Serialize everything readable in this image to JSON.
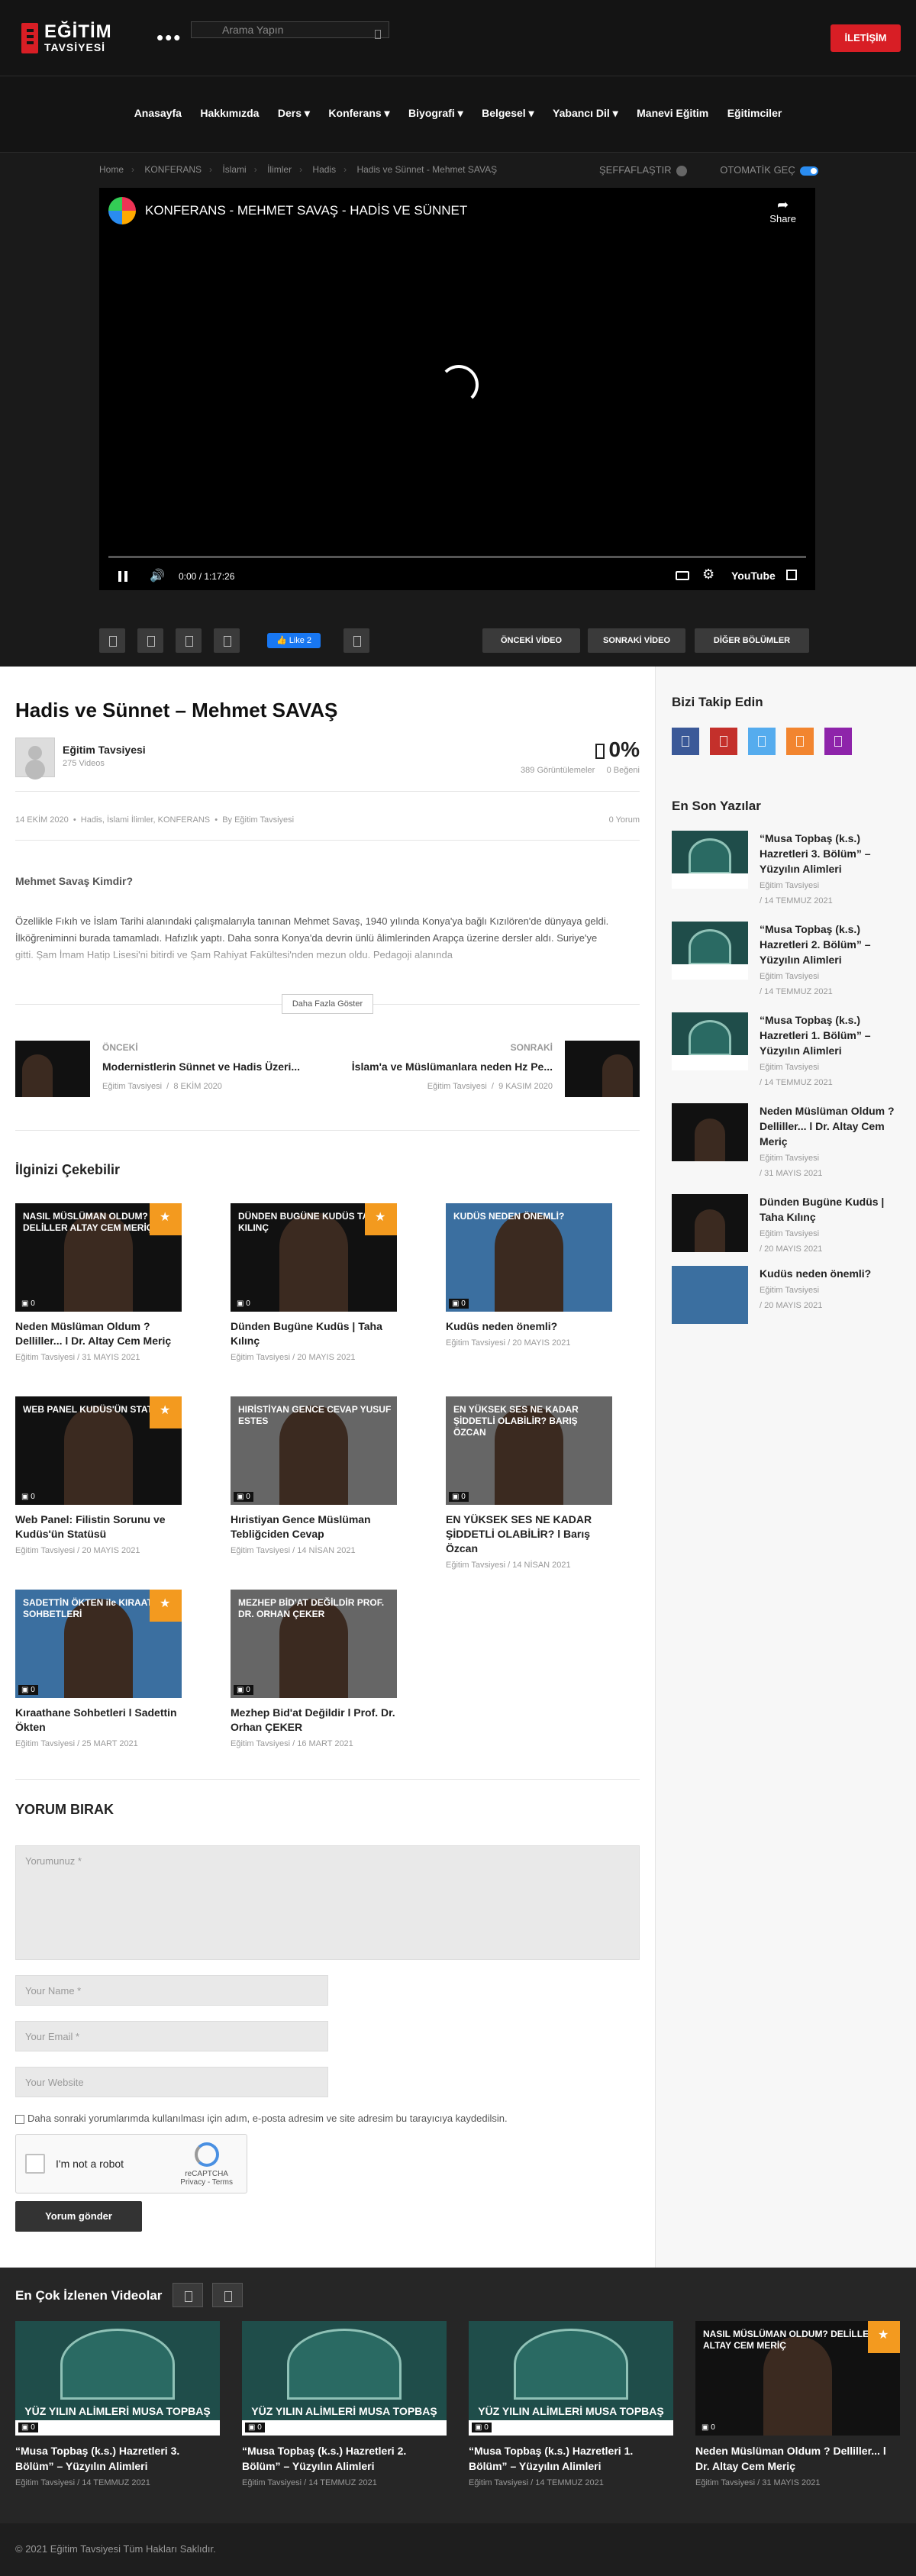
{
  "header": {
    "logo_line1": "EĞİTİM",
    "logo_line2": "TAVSİYESİ",
    "dots": "•••",
    "search_placeholder": "Arama Yapın",
    "contact_label": "İLETİŞİM"
  },
  "nav": {
    "items": [
      "Anasayfa",
      "Hakkımızda",
      "Ders ▾",
      "Konferans ▾",
      "Biyografi ▾",
      "Belgesel ▾",
      "Yabancı Dil ▾",
      "Manevi Eğitim",
      "Eğitimciler"
    ]
  },
  "breadcrumb": {
    "items": [
      "Home",
      "KONFERANS",
      "İslami",
      "İlimler",
      "Hadis",
      "Hadis ve Sünnet - Mehmet SAVAŞ"
    ],
    "sep": "›"
  },
  "toggles": {
    "transparent_label": "ŞEFFAFLAŞTIR",
    "autoplay_label": "OTOMATİK GEÇ"
  },
  "player": {
    "title": "KONFERANS - MEHMET SAVAŞ - HADİS VE SÜNNET",
    "share_label": "Share",
    "time": "0:00 / 1:17:26",
    "brand": "YouTube"
  },
  "toolbar": {
    "like_label": "👍 Like 2",
    "prev_video": "ÖNCEKİ VİDEO",
    "next_video": "SONRAKİ VİDEO",
    "other_episodes": "DİĞER BÖLÜMLER"
  },
  "post": {
    "title": "Hadis ve Sünnet – Mehmet SAVAŞ",
    "author": "Eğitim Tavsiyesi",
    "author_videos": "275 Videos",
    "like_percent": "0%",
    "views": "389 Görüntülemeler",
    "likes": "0 Beğeni",
    "date": "14 EKİM 2020",
    "categories": "Hadis, İslami İlimler, KONFERANS",
    "by": "By Eğitim Tavsiyesi",
    "comments": "0 Yorum",
    "section_title": "Mehmet Savaş Kimdir?",
    "body": "Özellikle Fıkıh ve İslam Tarihi alanındaki çalışmalarıyla tanınan Mehmet Savaş, 1940 yılında Konya'ya bağlı Kızılören'de dünyaya geldi. İlköğreniminni burada tamamladı. Hafızlık yaptı. Daha sonra Konya'da devrin ünlü âlimlerinden Arapça üzerine dersler aldı. Suriye'ye gitti. Şam İmam Hatip Lisesi'ni bitirdi ve Şam Rahiyat Fakültesi'nden mezun oldu. Pedagoji alanında",
    "show_more": "Daha Fazla Göster"
  },
  "prevnext": {
    "prev_tag": "ÖNCEKİ",
    "prev_title": "Modernistlerin Sünnet ve Hadis Üzeri...",
    "prev_author": "Eğitim Tavsiyesi",
    "prev_date": "8 EKİM 2020",
    "next_tag": "SONRAKİ",
    "next_title": "İslam'a ve Müslümanlara neden Hz Pe...",
    "next_author": "Eğitim Tavsiyesi",
    "next_date": "9 KASIM 2020"
  },
  "related": {
    "title": "İlginizi Çekebilir",
    "items": [
      {
        "title": "Neden Müslüman Oldum ? Delliller... l Dr. Altay Cem Meriç",
        "author": "Eğitim Tavsiyesi",
        "date": "31 MAYIS 2021",
        "badge": "▣ 0",
        "thumb_text": "NASIL MÜSLÜMAN OLDUM? DELİLLER ALTAY CEM MERİÇ"
      },
      {
        "title": "Dünden Bugüne Kudüs | Taha Kılınç",
        "author": "Eğitim Tavsiyesi",
        "date": "20 MAYIS 2021",
        "badge": "▣ 0",
        "thumb_text": "DÜNDEN BUGÜNE KUDÜS TAHA KILINÇ"
      },
      {
        "title": "Kudüs neden önemli?",
        "author": "Eğitim Tavsiyesi",
        "date": "20 MAYIS 2021",
        "badge": "▣ 0",
        "thumb_text": "KUDÜS NEDEN ÖNEMLİ?"
      },
      {
        "title": "Web Panel: Filistin Sorunu ve Kudüs'ün Statüsü",
        "author": "Eğitim Tavsiyesi",
        "date": "20 MAYIS 2021",
        "badge": "▣ 0",
        "thumb_text": "WEB PANEL KUDÜS'ÜN STATÜSÜ"
      },
      {
        "title": "Hıristiyan Gence Müslüman Tebliğciden Cevap",
        "author": "Eğitim Tavsiyesi",
        "date": "14 NİSAN 2021",
        "badge": "▣ 0",
        "thumb_text": "HIRİSTİYAN GENCE CEVAP YUSUF ESTES"
      },
      {
        "title": "EN YÜKSEK SES NE KADAR ŞİDDETLİ OLABİLİR? l Barış Özcan",
        "author": "Eğitim Tavsiyesi",
        "date": "14 NİSAN 2021",
        "badge": "▣ 0",
        "thumb_text": "EN YÜKSEK SES NE KADAR ŞİDDETLİ OLABİLİR? BARIŞ ÖZCAN"
      },
      {
        "title": "Kıraathane Sohbetleri l Sadettin Ökten",
        "author": "Eğitim Tavsiyesi",
        "date": "25 MART 2021",
        "badge": "▣ 0",
        "thumb_text": "SADETTİN ÖKTEN ile KIRAATHANE SOHBETLERİ"
      },
      {
        "title": "Mezhep Bid'at Değildir l Prof. Dr. Orhan ÇEKER",
        "author": "Eğitim Tavsiyesi",
        "date": "16 MART 2021",
        "badge": "▣ 0",
        "thumb_text": "MEZHEP BİD'AT DEĞİLDİR PROF. DR. ORHAN ÇEKER"
      }
    ]
  },
  "comment_form": {
    "title": "YORUM BIRAK",
    "textarea_placeholder": "Yorumunuz *",
    "name_placeholder": "Your Name *",
    "email_placeholder": "Your Email *",
    "website_placeholder": "Your Website",
    "checkbox_label": "Daha sonraki yorumlarımda kullanılması için adım, e-posta adresim ve site adresim bu tarayıcıya kaydedilsin.",
    "captcha_label": "I'm not a robot",
    "captcha_brand": "reCAPTCHA",
    "captcha_links": "Privacy - Terms",
    "submit_label": "Yorum gönder"
  },
  "sidebar": {
    "follow_title": "Bizi Takip Edin",
    "social": [
      {
        "name": "facebook",
        "color": "#3b5998"
      },
      {
        "name": "youtube",
        "color": "#c4302b"
      },
      {
        "name": "twitter",
        "color": "#55acee"
      },
      {
        "name": "rss",
        "color": "#f2852f"
      },
      {
        "name": "instagram",
        "color": "#8e24aa"
      }
    ],
    "recent_title": "En Son Yazılar",
    "recent": [
      {
        "title": "“Musa Topbaş (k.s.) Hazretleri 3. Bölüm” – Yüzyılın Alimleri",
        "author": "Eğitim Tavsiyesi",
        "date": "14 TEMMUZ 2021"
      },
      {
        "title": "“Musa Topbaş (k.s.) Hazretleri 2. Bölüm” – Yüzyılın Alimleri",
        "author": "Eğitim Tavsiyesi",
        "date": "14 TEMMUZ 2021"
      },
      {
        "title": "“Musa Topbaş (k.s.) Hazretleri 1. Bölüm” – Yüzyılın Alimleri",
        "author": "Eğitim Tavsiyesi",
        "date": "14 TEMMUZ 2021"
      },
      {
        "title": "Neden Müslüman Oldum ? Delliller... l Dr. Altay Cem Meriç",
        "author": "Eğitim Tavsiyesi",
        "date": "31 MAYIS 2021"
      },
      {
        "title": "Dünden Bugüne Kudüs | Taha Kılınç",
        "author": "Eğitim Tavsiyesi",
        "date": "20 MAYIS 2021"
      },
      {
        "title": "Kudüs neden önemli?",
        "author": "Eğitim Tavsiyesi",
        "date": "20 MAYIS 2021"
      }
    ]
  },
  "popular": {
    "title": "En Çok İzlenen Videolar",
    "items": [
      {
        "title": "“Musa Topbaş (k.s.) Hazretleri 3. Bölüm” – Yüzyılın Alimleri",
        "author": "Eğitim Tavsiyesi",
        "date": "14 TEMMUZ 2021",
        "badge": "▣ 0",
        "thumb_text": "YÜZ YILIN ALİMLERİ MUSA TOPBAŞ"
      },
      {
        "title": "“Musa Topbaş (k.s.) Hazretleri 2. Bölüm” – Yüzyılın Alimleri",
        "author": "Eğitim Tavsiyesi",
        "date": "14 TEMMUZ 2021",
        "badge": "▣ 0",
        "thumb_text": "YÜZ YILIN ALİMLERİ MUSA TOPBAŞ"
      },
      {
        "title": "“Musa Topbaş (k.s.) Hazretleri 1. Bölüm” – Yüzyılın Alimleri",
        "author": "Eğitim Tavsiyesi",
        "date": "14 TEMMUZ 2021",
        "badge": "▣ 0",
        "thumb_text": "YÜZ YILIN ALİMLERİ MUSA TOPBAŞ"
      },
      {
        "title": "Neden Müslüman Oldum ? Delliller... l Dr. Altay Cem Meriç",
        "author": "Eğitim Tavsiyesi",
        "date": "31 MAYIS 2021",
        "badge": "▣ 0",
        "thumb_text": "NASIL MÜSLÜMAN OLDUM? DELİLLER ALTAY CEM MERİÇ"
      }
    ]
  },
  "footer": {
    "copyright": "© 2021 Eğitim Tavsiyesi Tüm Hakları Saklıdır."
  }
}
